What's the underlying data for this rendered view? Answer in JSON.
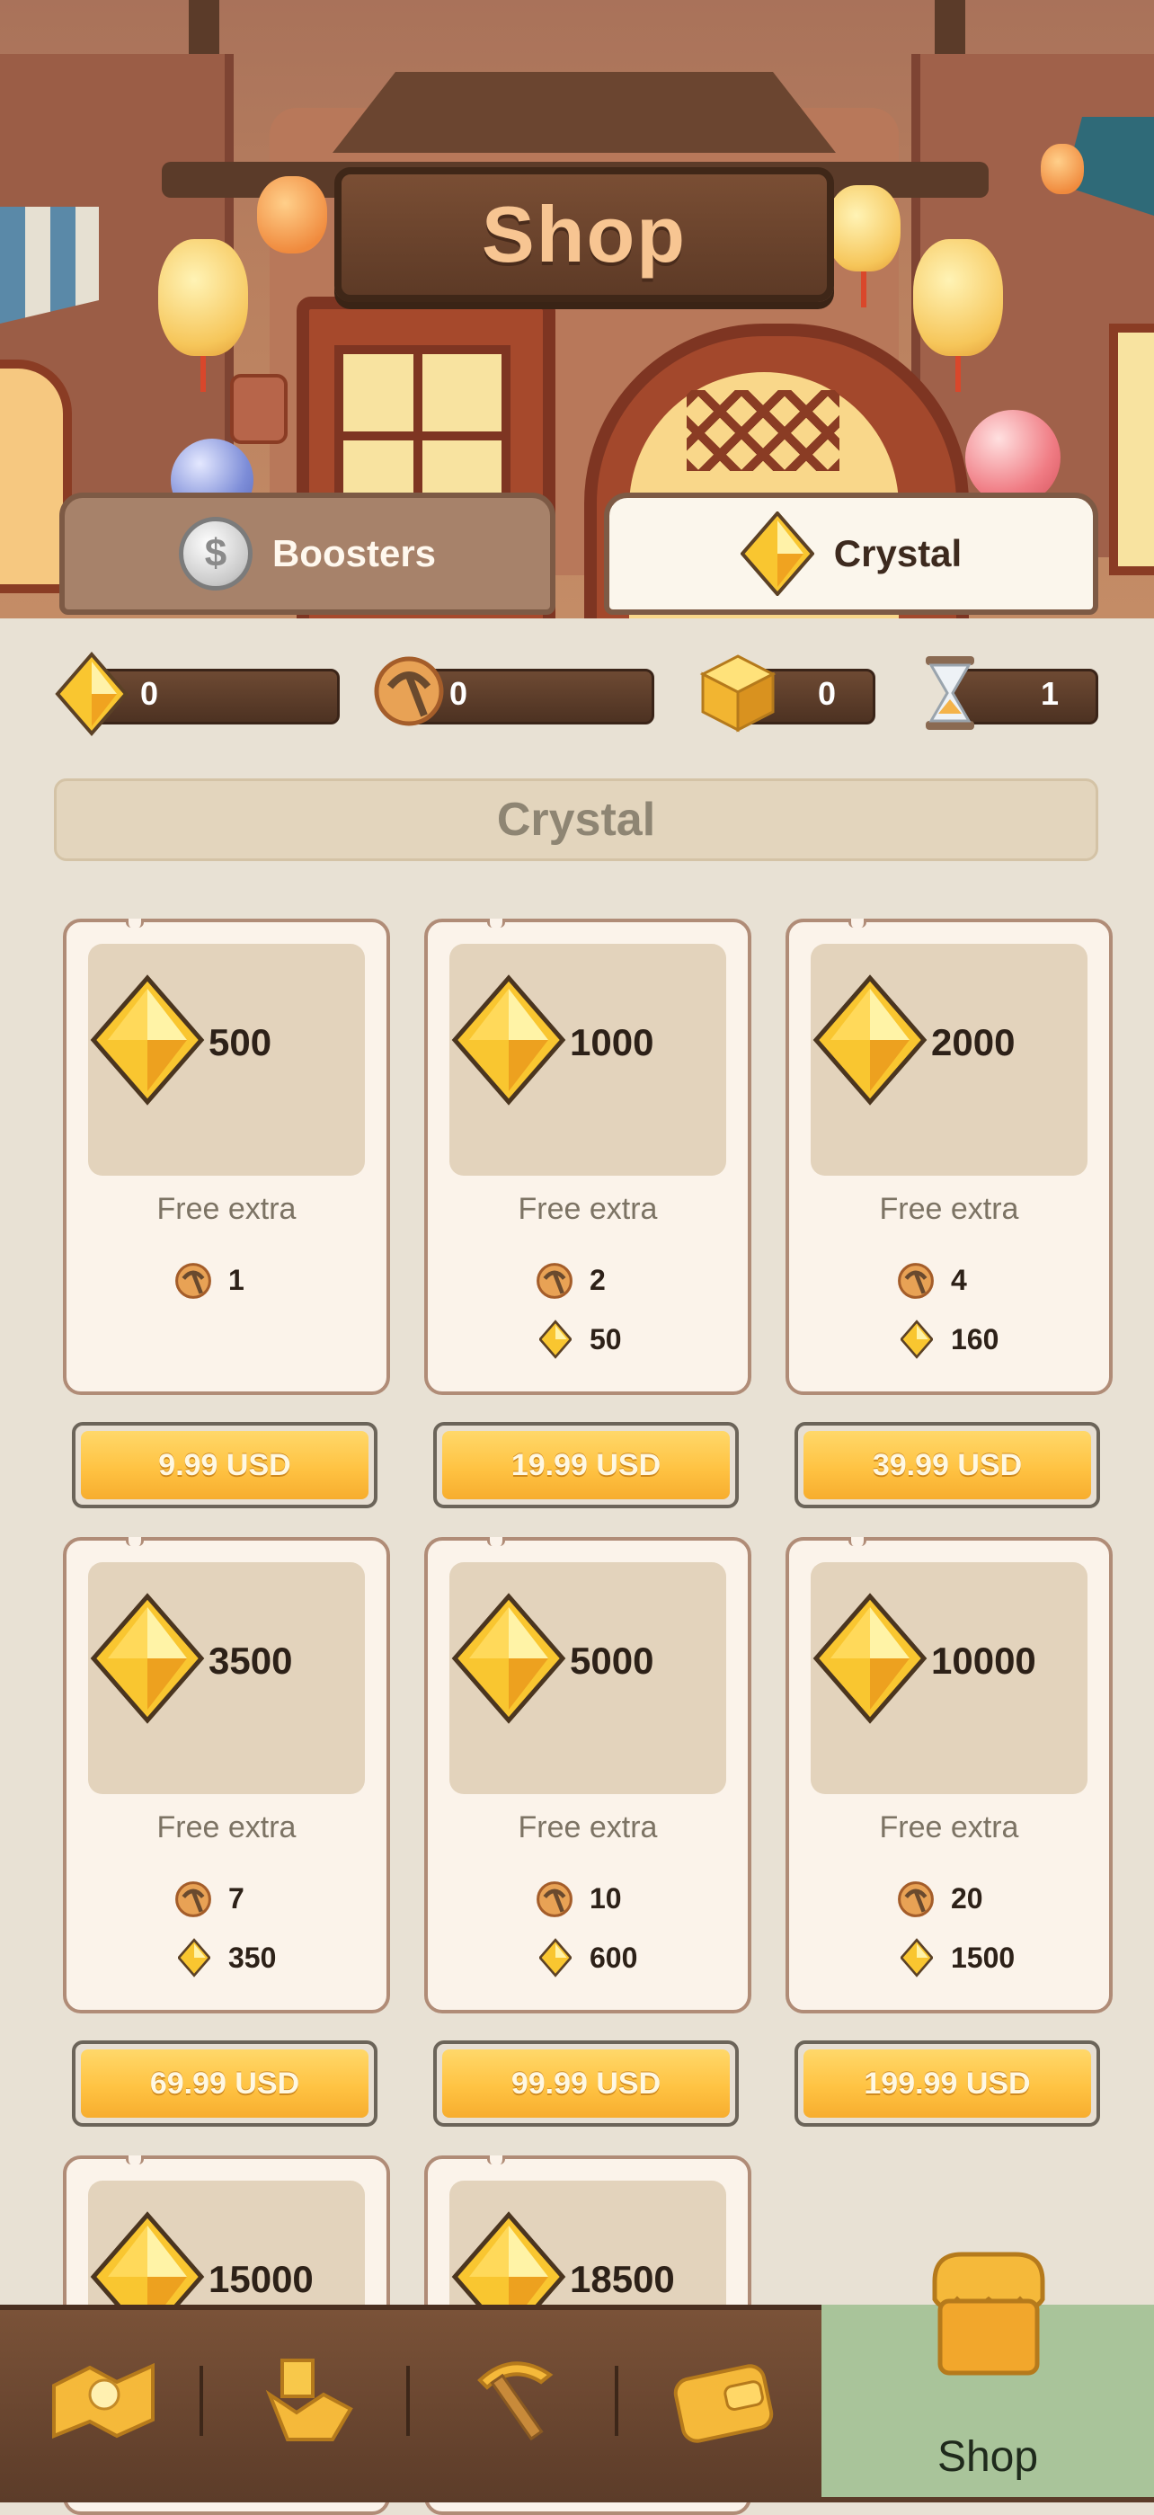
{
  "header": {
    "title": "Shop"
  },
  "tabs": [
    {
      "label": "Boosters",
      "icon": "silver-coin-icon",
      "active": false
    },
    {
      "label": "Crystal",
      "icon": "crystal-icon",
      "active": true
    }
  ],
  "currencies": [
    {
      "name": "crystal",
      "icon": "crystal-icon",
      "value": "0"
    },
    {
      "name": "pickaxe",
      "icon": "pickaxe-badge-icon",
      "value": "0"
    },
    {
      "name": "blocks",
      "icon": "gold-cube-icon",
      "value": "0"
    },
    {
      "name": "time",
      "icon": "hourglass-icon",
      "value": "1"
    }
  ],
  "section": {
    "title": "Crystal"
  },
  "packs": [
    {
      "amount": "500",
      "free_label": "Free extra",
      "bonus_pickaxe": "1",
      "bonus_crystal": "",
      "price": "9.99 USD"
    },
    {
      "amount": "1000",
      "free_label": "Free extra",
      "bonus_pickaxe": "2",
      "bonus_crystal": "50",
      "price": "19.99 USD"
    },
    {
      "amount": "2000",
      "free_label": "Free extra",
      "bonus_pickaxe": "4",
      "bonus_crystal": "160",
      "price": "39.99 USD"
    },
    {
      "amount": "3500",
      "free_label": "Free extra",
      "bonus_pickaxe": "7",
      "bonus_crystal": "350",
      "price": "69.99 USD"
    },
    {
      "amount": "5000",
      "free_label": "Free extra",
      "bonus_pickaxe": "10",
      "bonus_crystal": "600",
      "price": "99.99 USD"
    },
    {
      "amount": "10000",
      "free_label": "Free extra",
      "bonus_pickaxe": "20",
      "bonus_crystal": "1500",
      "price": "199.99 USD"
    },
    {
      "amount": "15000"
    },
    {
      "amount": "18500"
    }
  ],
  "bottom_nav": {
    "items": [
      {
        "icon": "treasure-map-icon"
      },
      {
        "icon": "mine-cart-icon"
      },
      {
        "icon": "pickaxe-icon"
      },
      {
        "icon": "wallet-icon"
      }
    ],
    "shop_label": "Shop",
    "shop_icon": "shop-stall-icon"
  },
  "colors": {
    "accent": "#ffc343",
    "active_nav": "#a9c49a",
    "wood": "#5d3a26",
    "background": "#e8e1d4"
  }
}
